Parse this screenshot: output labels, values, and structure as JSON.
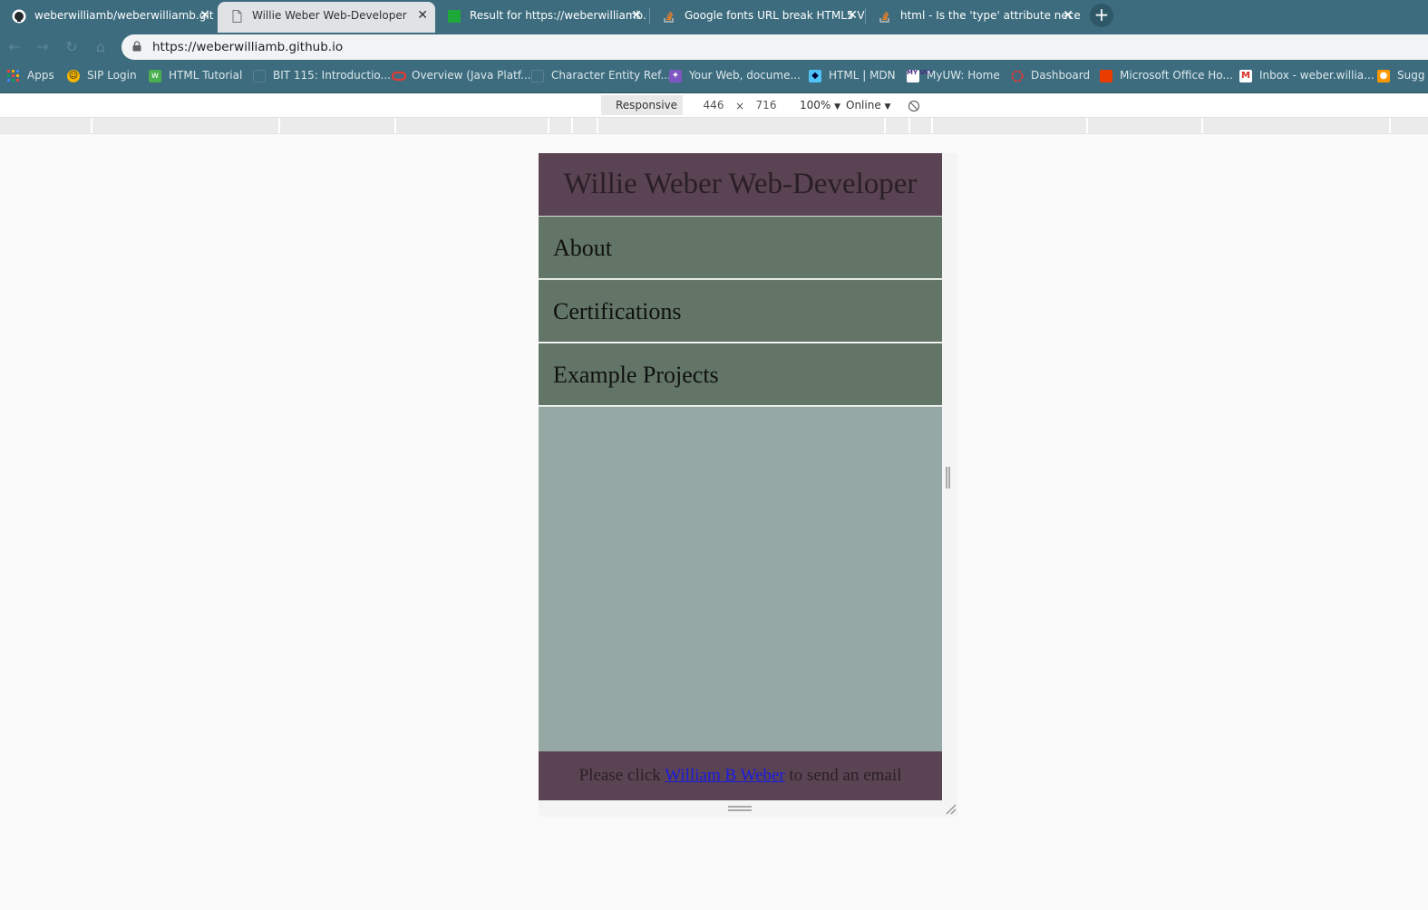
{
  "tabs": [
    {
      "title": "weberwilliamb/weberwilliamb.git",
      "icon": "github-icon",
      "active": false
    },
    {
      "title": "Willie Weber Web-Developer",
      "icon": "document-icon",
      "active": true
    },
    {
      "title": "Result for https://weberwilliamb.",
      "icon": "green-square-icon",
      "active": false
    },
    {
      "title": "Google fonts URL break HTML5 V",
      "icon": "stackoverflow-icon",
      "active": false
    },
    {
      "title": "html - Is the 'type' attribute nece",
      "icon": "stackoverflow-icon",
      "active": false
    }
  ],
  "tab_close_glyph": "✕",
  "new_tab_glyph": "+",
  "toolbar": {
    "back_glyph": "←",
    "forward_glyph": "→",
    "reload_glyph": "↻",
    "home_glyph": "⌂",
    "url": "https://weberwilliamb.github.io"
  },
  "bookmarks": [
    {
      "label": "Apps",
      "icon": "apps-grid-icon",
      "color": "#e8453c"
    },
    {
      "label": "SIP Login",
      "icon": "sip-icon",
      "color": "#f4b400"
    },
    {
      "label": "HTML Tutorial",
      "icon": "w3schools-icon",
      "color": "#4caf50"
    },
    {
      "label": "BIT 115: Introductio...",
      "icon": "page-icon",
      "color": "#5b7f8d"
    },
    {
      "label": "Overview (Java Platf...",
      "icon": "oracle-icon",
      "color": "#e53935"
    },
    {
      "label": "Character Entity Ref...",
      "icon": "page-icon",
      "color": "#5b7f8d"
    },
    {
      "label": "Your Web, docume...",
      "icon": "mdn-icon",
      "color": "#7e57c2"
    },
    {
      "label": "HTML | MDN",
      "icon": "mdn-dino-icon",
      "color": "#4fc3f7"
    },
    {
      "label": "MyUW: Home",
      "icon": "myuw-icon",
      "color": "#4b2e83"
    },
    {
      "label": "Dashboard",
      "icon": "canvas-icon",
      "color": "#e53935"
    },
    {
      "label": "Microsoft Office Ho...",
      "icon": "office-icon",
      "color": "#eb3c00"
    },
    {
      "label": "Inbox - weber.willia...",
      "icon": "gmail-icon",
      "color": "#d93025"
    },
    {
      "label": "Sugg",
      "icon": "bulb-icon",
      "color": "#ff9800"
    }
  ],
  "device_toolbar": {
    "device": "Responsive",
    "width": "446",
    "times": "×",
    "height": "716",
    "zoom": "100%",
    "network": "Online",
    "caret": "▼"
  },
  "site": {
    "title": "Willie Weber Web-Developer",
    "nav": [
      "About",
      "Certifications",
      "Example Projects"
    ],
    "footer_prefix": "Please click ",
    "footer_link": "William B Weber",
    "footer_suffix": " to send an email",
    "colors": {
      "header_bg": "#5a4352",
      "nav_bg": "#627566",
      "content_bg": "#95a8a3",
      "link": "#1a1ae0"
    }
  }
}
